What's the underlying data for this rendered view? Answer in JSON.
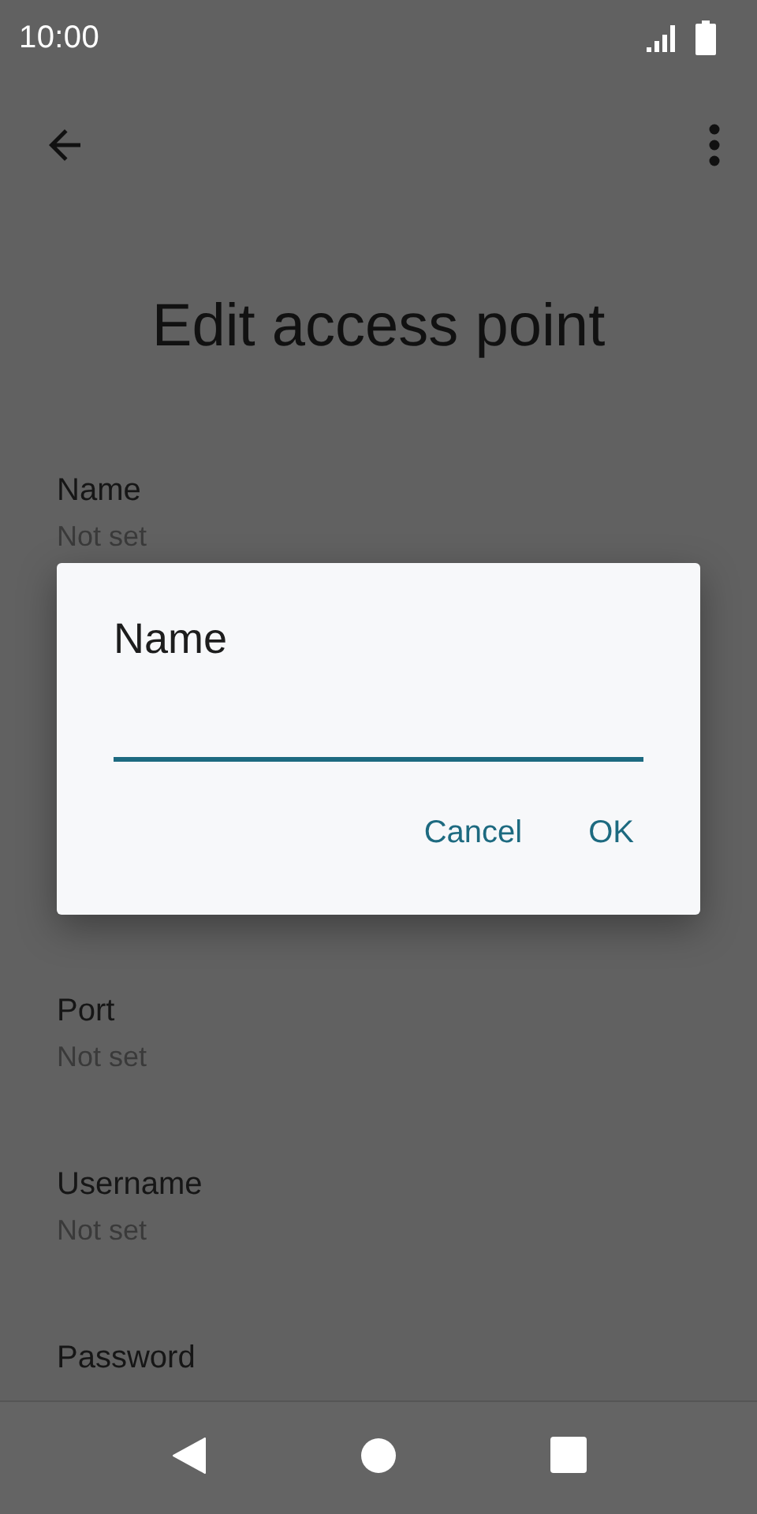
{
  "status_bar": {
    "time": "10:00"
  },
  "toolbar": {
    "title": "Edit access point"
  },
  "settings_top": [
    {
      "label": "Name",
      "summary": "Not set"
    }
  ],
  "settings_bottom": [
    {
      "label": "Port",
      "summary": "Not set"
    },
    {
      "label": "Username",
      "summary": "Not set"
    },
    {
      "label": "Password"
    }
  ],
  "dialog": {
    "title": "Name",
    "buttons": [
      "Cancel",
      "OK"
    ]
  }
}
